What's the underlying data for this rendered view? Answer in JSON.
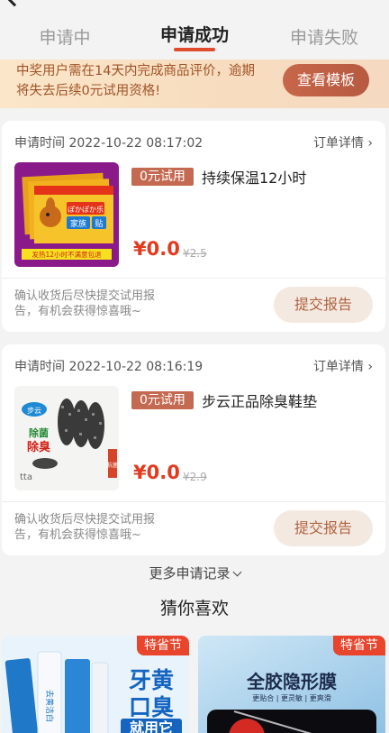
{
  "tabs": [
    {
      "label": "申请中"
    },
    {
      "label": "申请成功"
    },
    {
      "label": "申请失败"
    }
  ],
  "banner": {
    "text": "中奖用户需在14天内完成商品评价，逾期将失去后续0元试用资格!",
    "button": "查看模板"
  },
  "orders": [
    {
      "time": "申请时间 2022-10-22 08:17:02",
      "detail": "订单详情 ›",
      "badge": "0元试用",
      "title": "持续保温12小时",
      "price": "¥0.0",
      "original_price": "¥2.5",
      "footer": "确认收货后尽快提交试用报告，有机会获得惊喜哦~",
      "button": "提交报告"
    },
    {
      "time": "申请时间 2022-10-22 08:16:19",
      "detail": "订单详情 ›",
      "badge": "0元试用",
      "title": "步云正品除臭鞋垫",
      "price": "¥0.0",
      "original_price": "¥2.9",
      "footer": "确认收货后尽快提交试用报告，有机会获得惊喜哦~",
      "button": "提交报告"
    }
  ],
  "more": "更多申请记录",
  "guess_title": "猜你喜欢",
  "recommendations": [
    {
      "tag": "特省节",
      "headline1": "牙黄",
      "headline2": "口臭",
      "headline3": "就用它",
      "product_text": "去黄洁白"
    },
    {
      "tag": "特省节",
      "headline": "全胶隐形膜",
      "sub": "更贴合 | 更灵敏 | 更爽滑"
    }
  ],
  "product_images": {
    "warmer_text1": "ぽかぽか乐",
    "warmer_text2": "家族",
    "warmer_text3": "贴",
    "warmer_footer": "发热12小时不满意包退",
    "insole_brand": "步云",
    "insole_text": "除臭",
    "insole_text2": "除菌",
    "insole_side": "抗菌",
    "insole_logo": "tta"
  },
  "colors": {
    "accent": "#e14b2d",
    "price": "#e23a1e",
    "badge": "#c56a52"
  }
}
